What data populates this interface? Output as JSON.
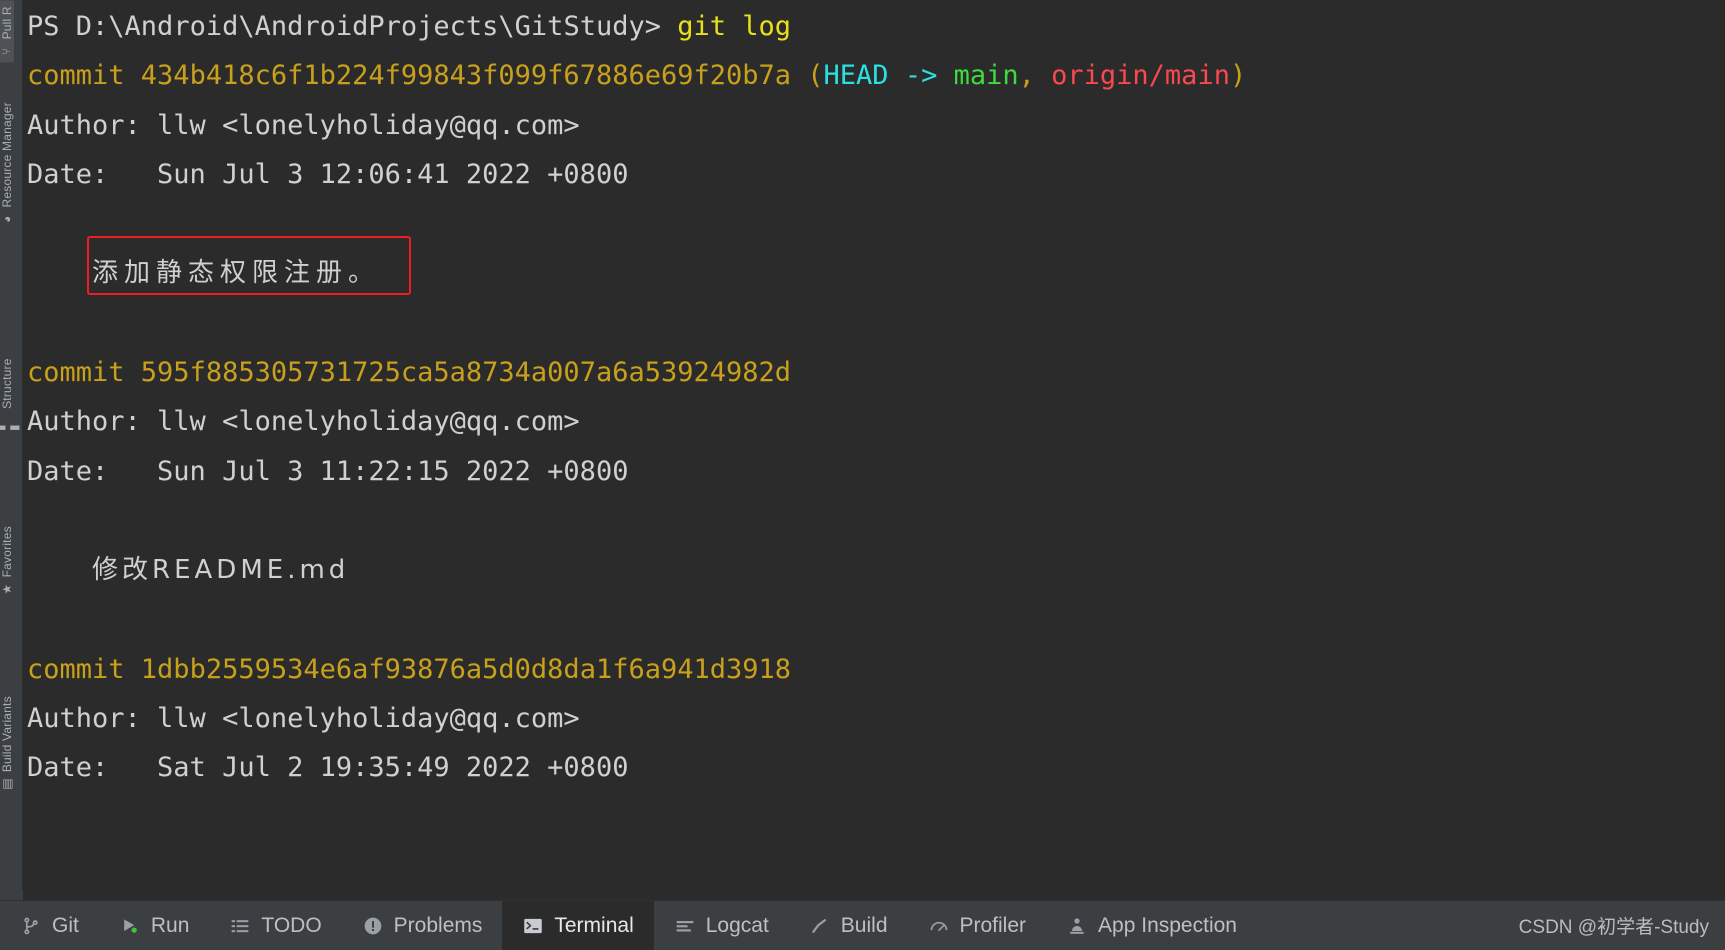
{
  "window": {
    "background": "#2b2b2b",
    "panel_background": "#3c3f41"
  },
  "colors": {
    "prompt_text": "#d0d0d0",
    "command": "#e8e11a",
    "commit_hash": "#c9a01b",
    "head_ref": "#2ae0e0",
    "local_branch": "#3ddb3d",
    "remote_branch": "#f9484e",
    "highlight_box": "#ee1c25",
    "tab_active_bg": "#2b2b2b"
  },
  "sidebar": {
    "items": [
      {
        "label": "Pull R",
        "icon": "pull-request-icon",
        "name": "sidebar-item-pull-requests"
      },
      {
        "label": "Resource Manager",
        "icon": "resource-manager-icon",
        "name": "sidebar-item-resource-manager"
      },
      {
        "label": "Structure",
        "icon": "structure-icon",
        "name": "sidebar-item-structure"
      },
      {
        "label": "Favorites",
        "icon": "star-icon",
        "name": "sidebar-item-favorites"
      },
      {
        "label": "Build Variants",
        "icon": "build-variants-icon",
        "name": "sidebar-item-build-variants"
      }
    ]
  },
  "terminal": {
    "prompt": {
      "prefix": "PS ",
      "path": "D:\\Android\\AndroidProjects\\GitStudy",
      "caret": "> ",
      "command": "git log"
    },
    "lines": [
      {
        "type": "commit",
        "keyword": "commit ",
        "hash": "434b418c6f1b224f99843f099f67886e69f20b7a",
        "refs_open": " (",
        "head": "HEAD",
        "arrow": " -> ",
        "branch": "main",
        "comma": ", ",
        "remote": "origin/main",
        "refs_close": ")"
      },
      {
        "type": "author",
        "label": "Author: ",
        "value": "llw <lonelyholiday@qq.com>"
      },
      {
        "type": "date",
        "label": "Date:   ",
        "value": "Sun Jul 3 12:06:41 2022 +0800"
      },
      {
        "type": "blank",
        "value": ""
      },
      {
        "type": "message",
        "value": "添加静态权限注册。",
        "highlighted": true
      },
      {
        "type": "blank",
        "value": ""
      },
      {
        "type": "commit",
        "keyword": "commit ",
        "hash": "595f885305731725ca5a8734a007a6a53924982d",
        "refs_open": "",
        "head": "",
        "arrow": "",
        "branch": "",
        "comma": "",
        "remote": "",
        "refs_close": ""
      },
      {
        "type": "author",
        "label": "Author: ",
        "value": "llw <lonelyholiday@qq.com>"
      },
      {
        "type": "date",
        "label": "Date:   ",
        "value": "Sun Jul 3 11:22:15 2022 +0800"
      },
      {
        "type": "blank",
        "value": ""
      },
      {
        "type": "message",
        "value": "修改README.md",
        "highlighted": false
      },
      {
        "type": "blank",
        "value": ""
      },
      {
        "type": "commit",
        "keyword": "commit ",
        "hash": "1dbb2559534e6af93876a5d0d8da1f6a941d3918",
        "refs_open": "",
        "head": "",
        "arrow": "",
        "branch": "",
        "comma": "",
        "remote": "",
        "refs_close": ""
      },
      {
        "type": "author",
        "label": "Author: ",
        "value": "llw <lonelyholiday@qq.com>"
      },
      {
        "type": "date",
        "label": "Date:   ",
        "value": "Sat Jul 2 19:35:49 2022 +0800"
      }
    ]
  },
  "tabbar": {
    "tabs": [
      {
        "label": "Git",
        "icon": "git-branch-icon",
        "active": false,
        "name": "tab-git"
      },
      {
        "label": "Run",
        "icon": "run-play-icon",
        "active": false,
        "name": "tab-run"
      },
      {
        "label": "TODO",
        "icon": "todo-list-icon",
        "active": false,
        "name": "tab-todo"
      },
      {
        "label": "Problems",
        "icon": "warning-icon",
        "active": false,
        "name": "tab-problems"
      },
      {
        "label": "Terminal",
        "icon": "terminal-icon",
        "active": true,
        "name": "tab-terminal"
      },
      {
        "label": "Logcat",
        "icon": "logcat-lines-icon",
        "active": false,
        "name": "tab-logcat"
      },
      {
        "label": "Build",
        "icon": "hammer-icon",
        "active": false,
        "name": "tab-build"
      },
      {
        "label": "Profiler",
        "icon": "gauge-icon",
        "active": false,
        "name": "tab-profiler"
      },
      {
        "label": "App Inspection",
        "icon": "app-inspection-icon",
        "active": false,
        "name": "tab-app-inspection"
      }
    ],
    "watermark": "CSDN @初学者-Study"
  }
}
